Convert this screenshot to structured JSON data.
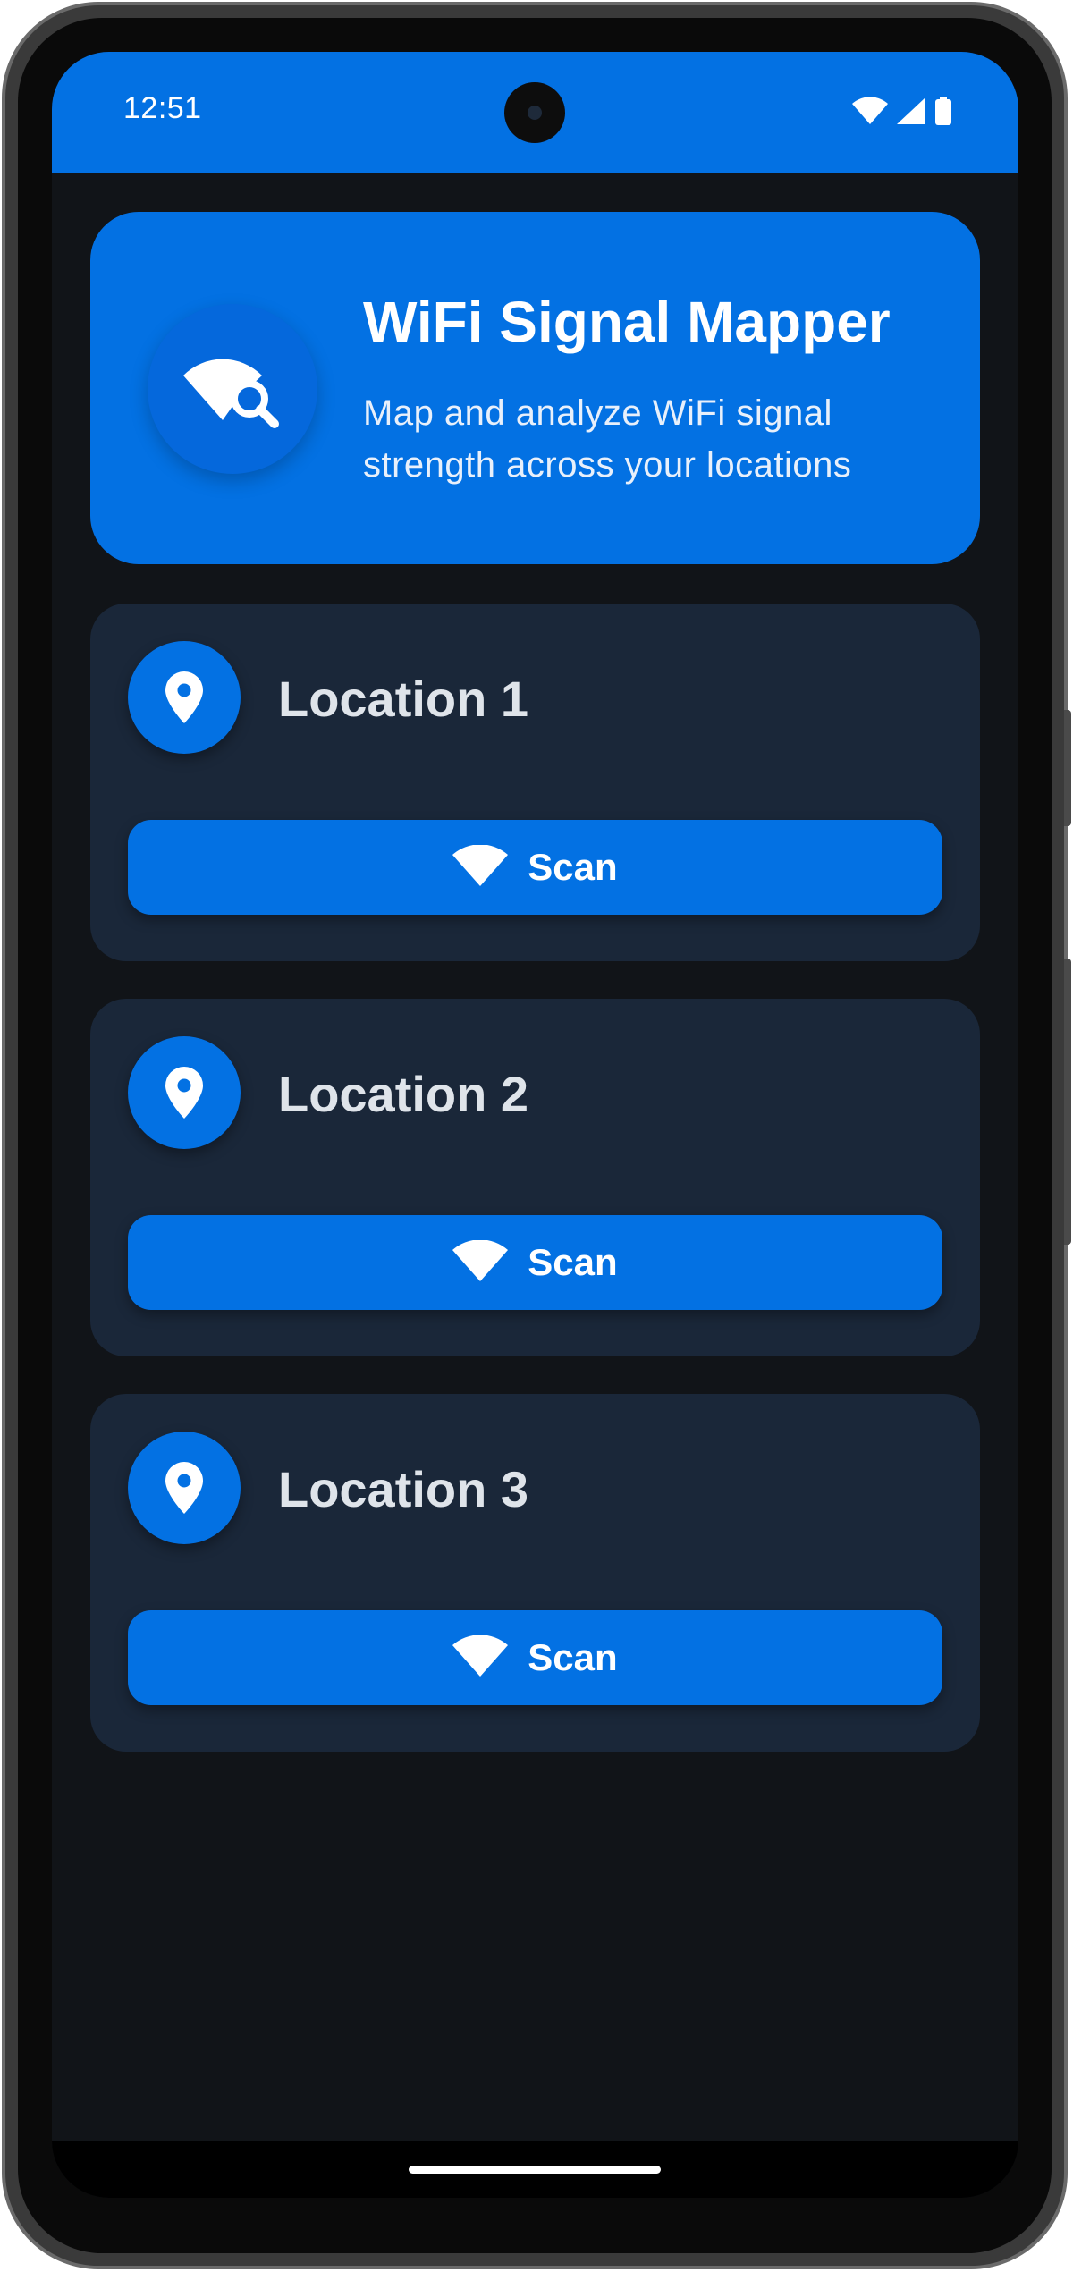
{
  "status_bar": {
    "time": "12:51",
    "icons": [
      "wifi-icon",
      "cellular-signal-icon",
      "battery-icon"
    ]
  },
  "header": {
    "title": "WiFi Signal Mapper",
    "subtitle": "Map and analyze WiFi signal strength across your locations",
    "icon": "wifi-search-icon"
  },
  "locations": [
    {
      "name": "Location 1",
      "icon": "location-pin-icon",
      "scan_label": "Scan",
      "scan_icon": "wifi-icon"
    },
    {
      "name": "Location 2",
      "icon": "location-pin-icon",
      "scan_label": "Scan",
      "scan_icon": "wifi-icon"
    },
    {
      "name": "Location 3",
      "icon": "location-pin-icon",
      "scan_label": "Scan",
      "scan_icon": "wifi-icon"
    }
  ],
  "colors": {
    "accent": "#0371e3",
    "background": "#111418",
    "card": "#1a2739",
    "text_primary": "#dfe4ea"
  }
}
